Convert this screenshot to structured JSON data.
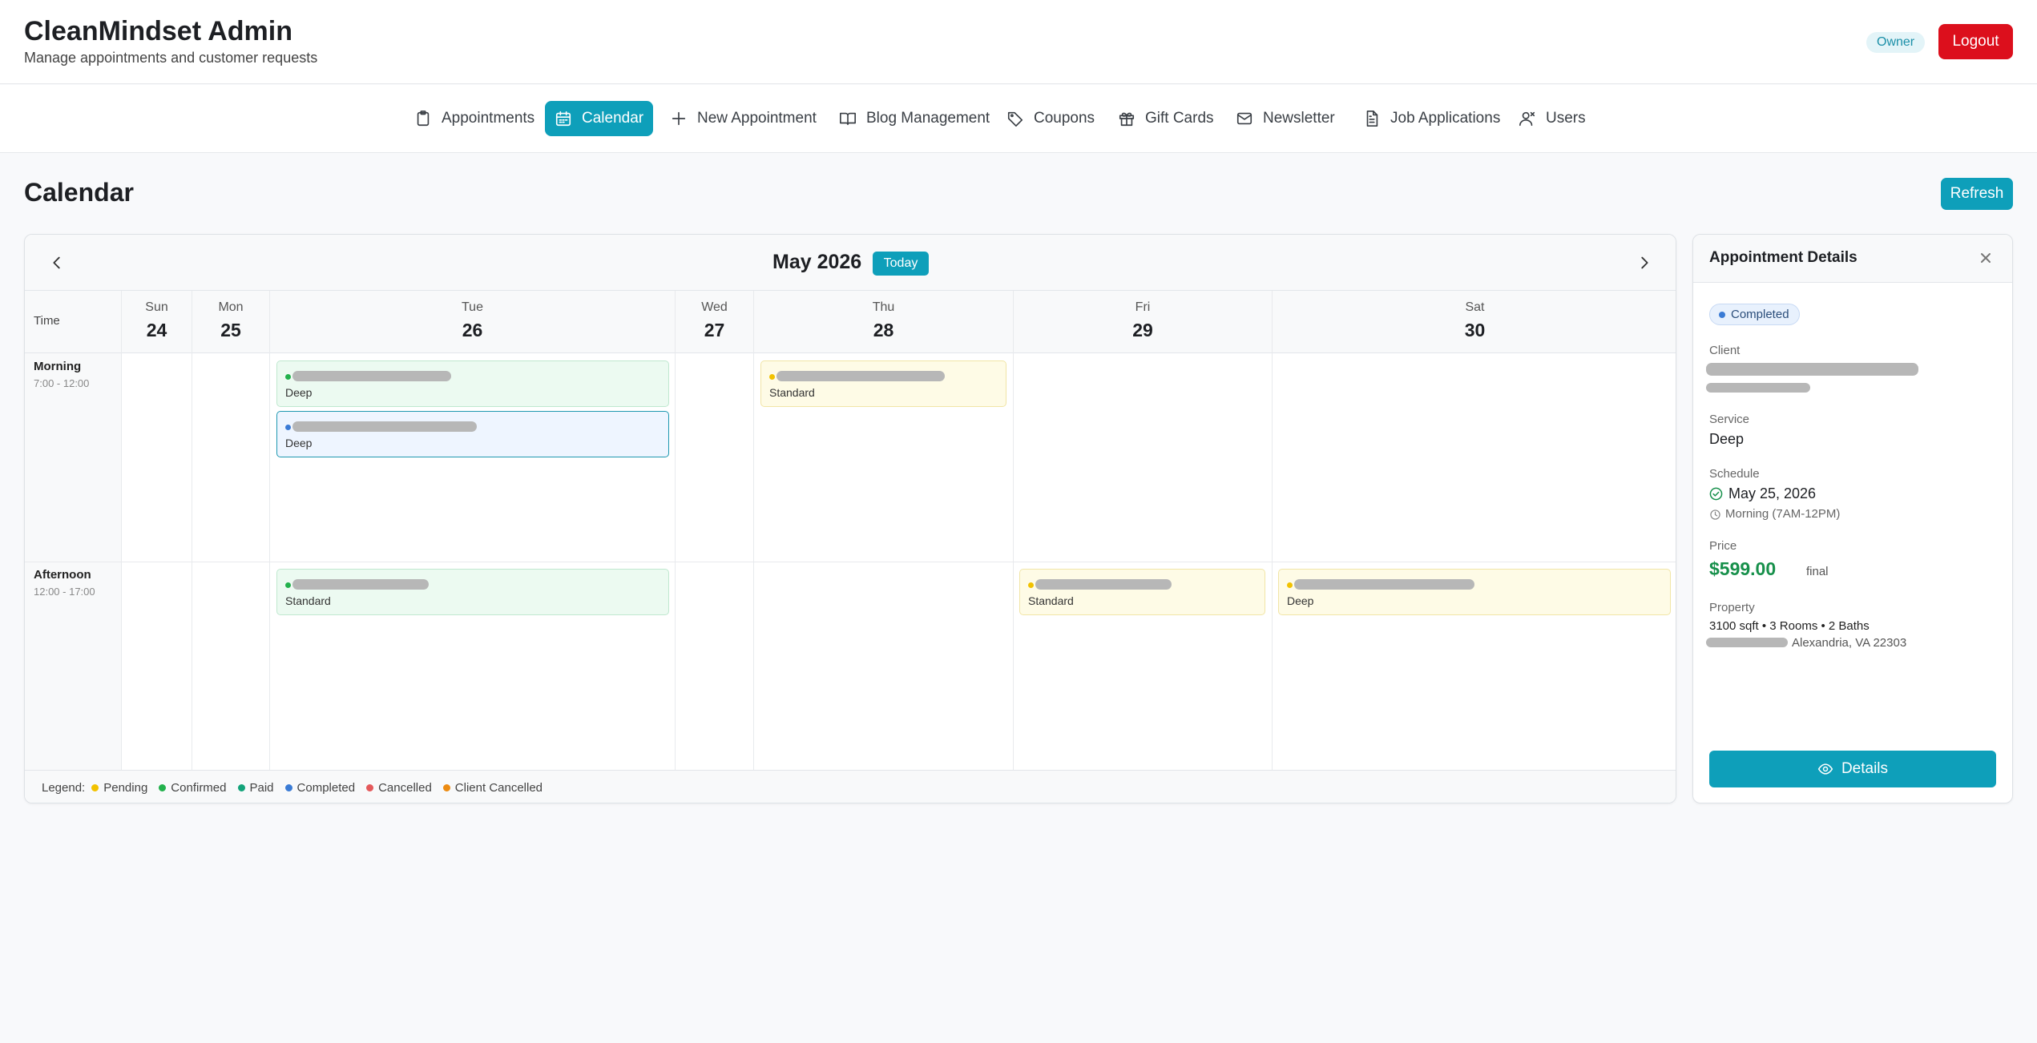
{
  "header": {
    "title": "CleanMindset Admin",
    "subtitle": "Manage appointments and customer requests",
    "role_badge": "Owner",
    "logout_label": "Logout"
  },
  "nav": {
    "items": [
      {
        "label": "Appointments",
        "icon": "clipboard-icon",
        "active": false
      },
      {
        "label": "Calendar",
        "icon": "calendar-icon",
        "active": true
      },
      {
        "label": "New Appointment",
        "icon": "plus-icon",
        "active": false
      },
      {
        "label": "Blog Management",
        "icon": "book-icon",
        "active": false
      },
      {
        "label": "Coupons",
        "icon": "tag-icon",
        "active": false
      },
      {
        "label": "Gift Cards",
        "icon": "gift-icon",
        "active": false
      },
      {
        "label": "Newsletter",
        "icon": "mail-icon",
        "active": false
      },
      {
        "label": "Job Applications",
        "icon": "document-icon",
        "active": false
      },
      {
        "label": "Users",
        "icon": "users-icon",
        "active": false
      }
    ]
  },
  "page": {
    "title": "Calendar",
    "refresh_label": "Refresh"
  },
  "calendar": {
    "month_label": "May 2026",
    "today_label": "Today",
    "time_header": "Time",
    "days": [
      {
        "dow": "Sun",
        "num": "24"
      },
      {
        "dow": "Mon",
        "num": "25"
      },
      {
        "dow": "Tue",
        "num": "26"
      },
      {
        "dow": "Wed",
        "num": "27"
      },
      {
        "dow": "Thu",
        "num": "28"
      },
      {
        "dow": "Fri",
        "num": "29"
      },
      {
        "dow": "Sat",
        "num": "30"
      }
    ],
    "slots": [
      {
        "label": "Morning",
        "range": "7:00 - 12:00"
      },
      {
        "label": "Afternoon",
        "range": "12:00 - 17:00"
      }
    ],
    "appointments": [
      {
        "day": "Tue",
        "slot": "Morning",
        "service": "Deep",
        "status": "Confirmed",
        "client_redacted": true
      },
      {
        "day": "Tue",
        "slot": "Morning",
        "service": "Deep",
        "status": "Completed",
        "selected": true,
        "client_redacted": true
      },
      {
        "day": "Thu",
        "slot": "Morning",
        "service": "Standard",
        "status": "Pending",
        "client_redacted": true
      },
      {
        "day": "Tue",
        "slot": "Afternoon",
        "service": "Standard",
        "status": "Confirmed",
        "client_redacted": true
      },
      {
        "day": "Fri",
        "slot": "Afternoon",
        "service": "Standard",
        "status": "Pending",
        "client_redacted": true
      },
      {
        "day": "Sat",
        "slot": "Afternoon",
        "service": "Deep",
        "status": "Pending",
        "client_redacted": true
      }
    ],
    "legend_title": "Legend:",
    "legend": [
      {
        "label": "Pending",
        "color": "#f2c200"
      },
      {
        "label": "Confirmed",
        "color": "#22b14c"
      },
      {
        "label": "Paid",
        "color": "#13a37a"
      },
      {
        "label": "Completed",
        "color": "#3a7bd5"
      },
      {
        "label": "Cancelled",
        "color": "#e4595b"
      },
      {
        "label": "Client Cancelled",
        "color": "#ec8b12"
      }
    ]
  },
  "details": {
    "title": "Appointment Details",
    "status": "Completed",
    "client_label": "Client",
    "service_label": "Service",
    "service_value": "Deep",
    "schedule_label": "Schedule",
    "schedule_date": "May 25, 2026",
    "schedule_time": "Morning (7AM-12PM)",
    "price_label": "Price",
    "price_value": "$599.00",
    "price_note": "final",
    "property_label": "Property",
    "property_summary": "3100 sqft • 3 Rooms • 2 Baths",
    "property_address": "Alexandria, VA 22303",
    "details_button": "Details"
  },
  "colors": {
    "accent": "#0e9fba",
    "logout": "#dc0f1c",
    "price": "#17904b"
  }
}
